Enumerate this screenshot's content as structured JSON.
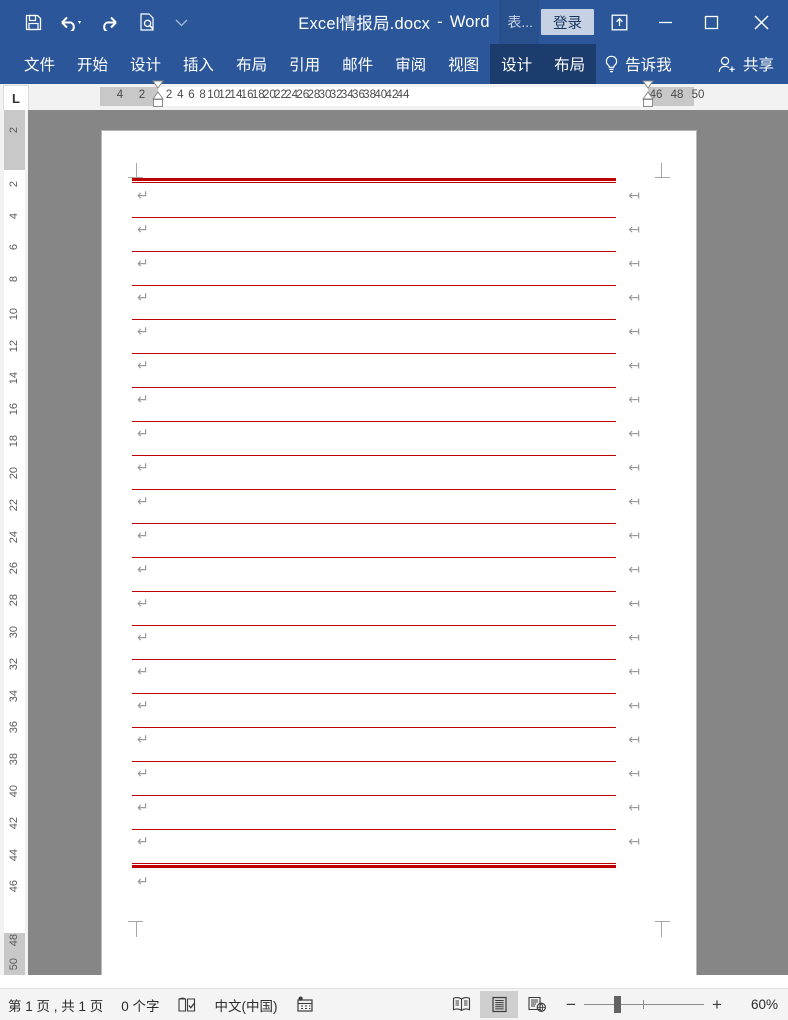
{
  "titlebar": {
    "quick_access": [
      {
        "name": "save-icon",
        "label": "保存"
      },
      {
        "name": "undo-icon",
        "label": "撤消"
      },
      {
        "name": "redo-icon",
        "label": "恢复"
      },
      {
        "name": "print-preview-icon",
        "label": "打印预览和打印"
      },
      {
        "name": "customize-qat-icon",
        "label": "自定义快速访问工具栏"
      }
    ],
    "document_name": "Excel情报局.docx",
    "separator": "-",
    "app_name": "Word",
    "table_tools_label": "表...",
    "signin_label": "登录",
    "restore_icon": "restore-down-icon",
    "minimize_label": "─",
    "maximize_label": "☐",
    "close_label": "✕"
  },
  "ribbon": {
    "tabs": [
      {
        "label": "文件",
        "contextual": false,
        "active": false
      },
      {
        "label": "开始",
        "contextual": false,
        "active": false
      },
      {
        "label": "设计",
        "contextual": false,
        "active": false
      },
      {
        "label": "插入",
        "contextual": false,
        "active": false
      },
      {
        "label": "布局",
        "contextual": false,
        "active": false
      },
      {
        "label": "引用",
        "contextual": false,
        "active": false
      },
      {
        "label": "邮件",
        "contextual": false,
        "active": false
      },
      {
        "label": "审阅",
        "contextual": false,
        "active": false
      },
      {
        "label": "视图",
        "contextual": false,
        "active": false
      },
      {
        "label": "设计",
        "contextual": true,
        "active": false
      },
      {
        "label": "布局",
        "contextual": true,
        "active": false
      }
    ],
    "tell_me_label": "告诉我",
    "share_label": "共享",
    "bar_color": "#2b579a",
    "contextual_color": "#1c3c6e"
  },
  "ruler": {
    "tab_selector_glyph": "L",
    "horizontal": {
      "left_margin_numbers": [
        4,
        2
      ],
      "numbers": [
        2,
        4,
        6,
        8,
        10,
        12,
        14,
        16,
        18,
        20,
        22,
        24,
        26,
        28,
        30,
        32,
        34,
        36,
        38,
        40,
        42,
        44
      ],
      "right_margin_numbers": [
        46,
        48,
        50
      ]
    },
    "vertical": {
      "top_margin_numbers": [
        2
      ],
      "numbers": [
        2,
        4,
        6,
        8,
        10,
        12,
        14,
        16,
        18,
        20,
        22,
        24,
        26,
        28,
        30,
        32,
        34,
        36,
        38,
        40,
        42,
        44,
        46
      ],
      "bottom_margin_numbers": [
        48,
        50
      ]
    }
  },
  "document": {
    "table": {
      "border_color": "#c00000",
      "row_count": 20,
      "rows": [
        {
          "paragraph_mark": "↵",
          "end_of_row_mark": "↤",
          "text": ""
        },
        {
          "paragraph_mark": "↵",
          "end_of_row_mark": "↤",
          "text": ""
        },
        {
          "paragraph_mark": "↵",
          "end_of_row_mark": "↤",
          "text": ""
        },
        {
          "paragraph_mark": "↵",
          "end_of_row_mark": "↤",
          "text": ""
        },
        {
          "paragraph_mark": "↵",
          "end_of_row_mark": "↤",
          "text": ""
        },
        {
          "paragraph_mark": "↵",
          "end_of_row_mark": "↤",
          "text": ""
        },
        {
          "paragraph_mark": "↵",
          "end_of_row_mark": "↤",
          "text": ""
        },
        {
          "paragraph_mark": "↵",
          "end_of_row_mark": "↤",
          "text": ""
        },
        {
          "paragraph_mark": "↵",
          "end_of_row_mark": "↤",
          "text": ""
        },
        {
          "paragraph_mark": "↵",
          "end_of_row_mark": "↤",
          "text": ""
        },
        {
          "paragraph_mark": "↵",
          "end_of_row_mark": "↤",
          "text": ""
        },
        {
          "paragraph_mark": "↵",
          "end_of_row_mark": "↤",
          "text": ""
        },
        {
          "paragraph_mark": "↵",
          "end_of_row_mark": "↤",
          "text": ""
        },
        {
          "paragraph_mark": "↵",
          "end_of_row_mark": "↤",
          "text": ""
        },
        {
          "paragraph_mark": "↵",
          "end_of_row_mark": "↤",
          "text": ""
        },
        {
          "paragraph_mark": "↵",
          "end_of_row_mark": "↤",
          "text": ""
        },
        {
          "paragraph_mark": "↵",
          "end_of_row_mark": "↤",
          "text": ""
        },
        {
          "paragraph_mark": "↵",
          "end_of_row_mark": "↤",
          "text": ""
        },
        {
          "paragraph_mark": "↵",
          "end_of_row_mark": "↤",
          "text": ""
        },
        {
          "paragraph_mark": "↵",
          "end_of_row_mark": "↤",
          "text": ""
        }
      ]
    },
    "after_table_paragraph_mark": "↵"
  },
  "status": {
    "page_info": "第 1 页 , 共 1 页",
    "word_count": "0 个字",
    "proofing_icon": "proofing-errors-icon",
    "language": "中文(中国)",
    "macro_icon": "record-macro-icon",
    "views": [
      {
        "name": "read-mode-view",
        "active": false
      },
      {
        "name": "print-layout-view",
        "active": true
      },
      {
        "name": "web-layout-view",
        "active": false
      }
    ],
    "zoom_out_label": "−",
    "zoom_in_label": "+",
    "zoom_level": "60%"
  }
}
